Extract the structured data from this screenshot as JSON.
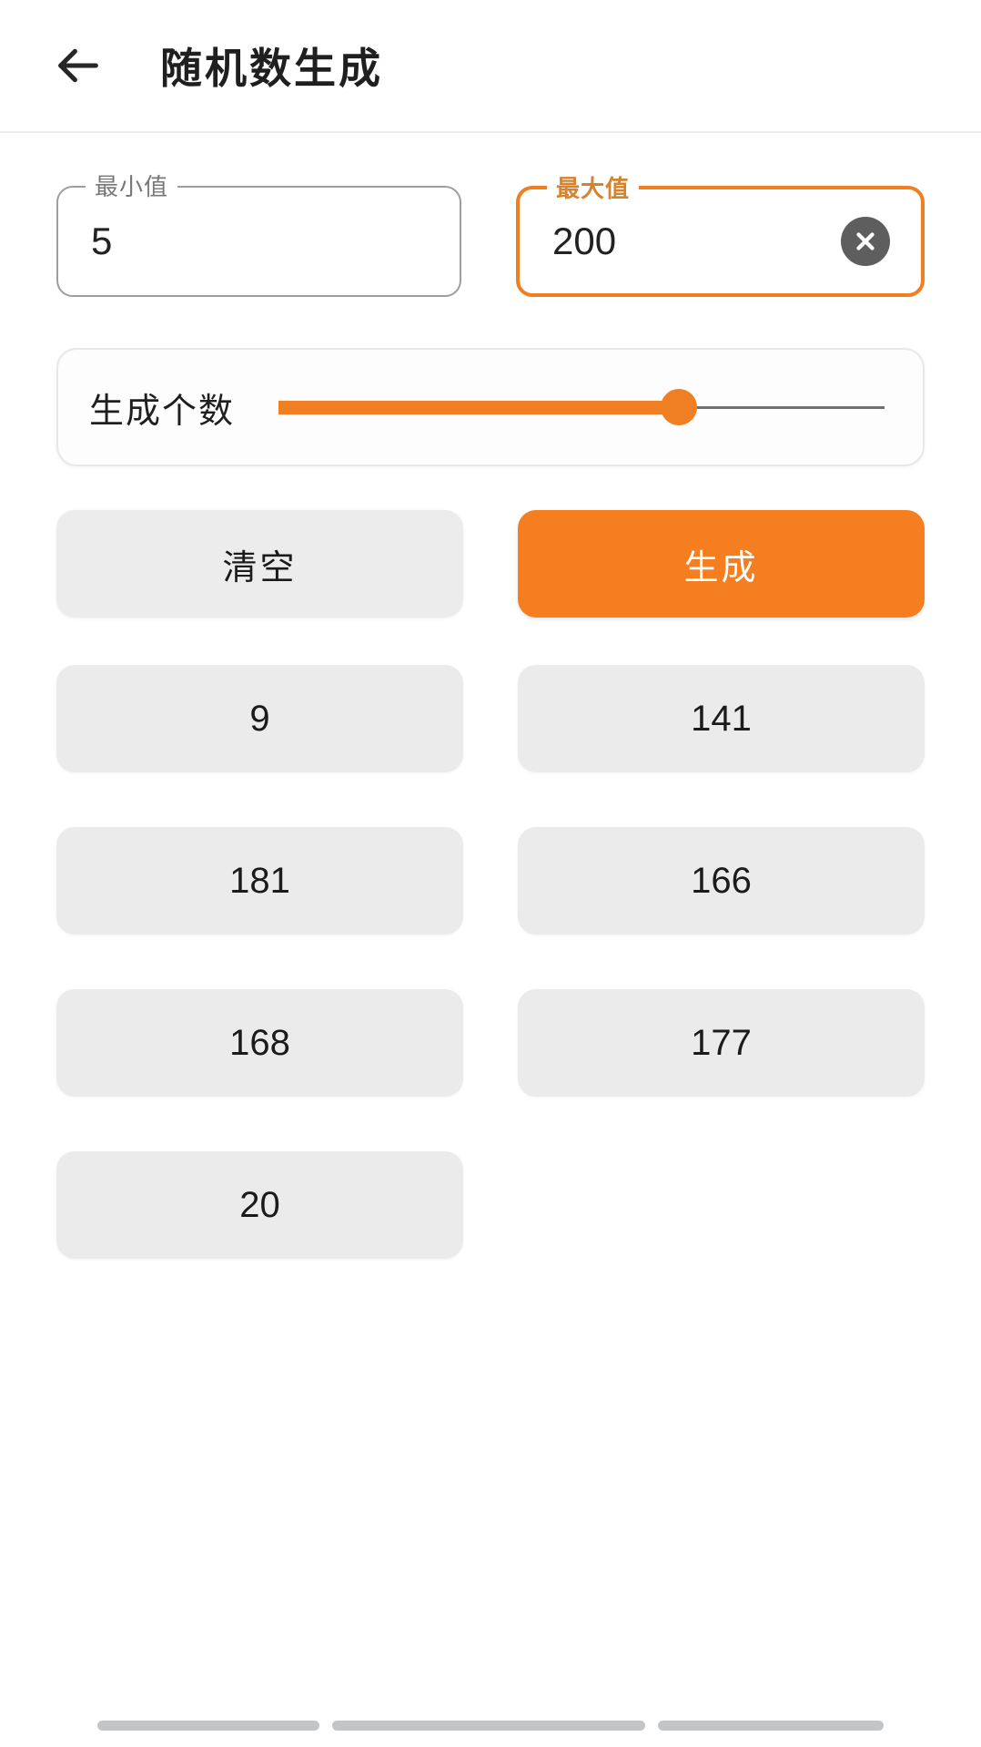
{
  "header": {
    "back_icon": "arrow-left-icon",
    "title": "随机数生成"
  },
  "form": {
    "min_field": {
      "label": "最小值",
      "value": "5",
      "focused": false
    },
    "max_field": {
      "label": "最大值",
      "value": "200",
      "focused": true,
      "clear_icon": "close-circle-icon"
    },
    "count_slider": {
      "label": "生成个数",
      "percent": 66,
      "fill_color": "#ef7f22",
      "track_color": "#707070"
    }
  },
  "actions": {
    "clear_label": "清空",
    "generate_label": "生成",
    "generate_color": "#f57f20"
  },
  "results": {
    "values": [
      "9",
      "141",
      "181",
      "166",
      "168",
      "177",
      "20"
    ]
  },
  "system_nav": {
    "pills": [
      "recents-bar",
      "home-bar",
      "back-bar"
    ]
  }
}
